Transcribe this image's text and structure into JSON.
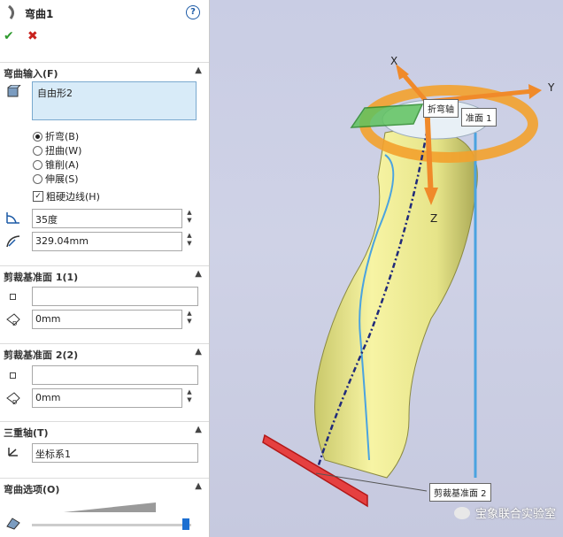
{
  "header": {
    "title": "弯曲1",
    "help": "?",
    "ok": "✔",
    "cancel": "✖"
  },
  "bend_input": {
    "section_label": "弯曲输入(F)",
    "body": "自由形2",
    "options": [
      {
        "label": "折弯(B)",
        "selected": true
      },
      {
        "label": "扭曲(W)",
        "selected": false
      },
      {
        "label": "锥削(A)",
        "selected": false
      },
      {
        "label": "伸展(S)",
        "selected": false
      }
    ],
    "hard_edges": {
      "label": "粗硬边线(H)",
      "checked": true
    },
    "angle": "35度",
    "radius": "329.04mm"
  },
  "trim_plane_1": {
    "section_label": "剪裁基准面 1(1)",
    "ref": "",
    "distance": "0mm"
  },
  "trim_plane_2": {
    "section_label": "剪裁基准面 2(2)",
    "ref": "",
    "distance": "0mm"
  },
  "triad": {
    "section_label": "三重轴(T)",
    "coord_system": "坐标系1"
  },
  "bend_options": {
    "section_label": "弯曲选项(O)",
    "accuracy": 0.98
  },
  "viewport": {
    "axis_x": "X",
    "axis_y": "Y",
    "axis_z": "Z",
    "bend_axis_tag": "折弯轴",
    "plane1_tag": "准面 1",
    "plane2_tag": "剪裁基准面 2",
    "watermark": "宝象联合实验室"
  }
}
